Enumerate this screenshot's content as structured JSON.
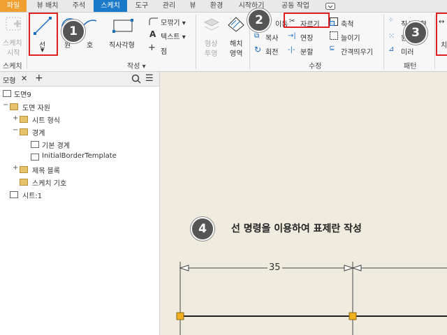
{
  "tabs": [
    "파일",
    "뷰 배치",
    "주석",
    "스케치",
    "도구",
    "관리",
    "뷰",
    "환경",
    "시작하기",
    "공동 작업"
  ],
  "ribbon": {
    "sketch_start": [
      "스케치",
      "시작"
    ],
    "sketch_group": "스케치",
    "line_label": "선",
    "circle_label": "원",
    "arc_label": "호",
    "rect_label": "직사각형",
    "fillet_label": "모깎기 ▾",
    "text_label": "텍스트 ▾",
    "point_label": "점",
    "create_group": "작성 ▾",
    "project_geom": [
      "형상",
      "투영"
    ],
    "hatch_label": [
      "해치",
      "영역"
    ],
    "move_label": "이동",
    "trim_label": "자르기",
    "scale_label": "축척",
    "copy_label": "복사",
    "extend_label": "연장",
    "stretch_label": "늘이기",
    "rotate_label": "회전",
    "split_label": "분할",
    "offset_label": "간격띄우기",
    "modify_group": "수정",
    "rect_pattern_label": "직사각형",
    "circ_pattern_label": "원형",
    "mirror_label": "미러",
    "pattern_group": "패턴",
    "dim_label": "치"
  },
  "browser": {
    "tab_label": "모형",
    "items": [
      "도면9",
      "도면 자원",
      "시트 형식",
      "경계",
      "기본 경계",
      "InitialBorderTemplate",
      "제목 블록",
      "스케치 기호",
      "시트:1"
    ]
  },
  "canvas": {
    "instruction": "선 명령을 이용하여 표제란 작성",
    "dimension": "35"
  },
  "badges": [
    "1",
    "2",
    "3",
    "4"
  ],
  "colors": {
    "accent": "#1a7ac9",
    "file_tab": "#f0a030",
    "highlight": "#e02020",
    "grip": "#f2b01e",
    "canvas": "#efebdf"
  }
}
